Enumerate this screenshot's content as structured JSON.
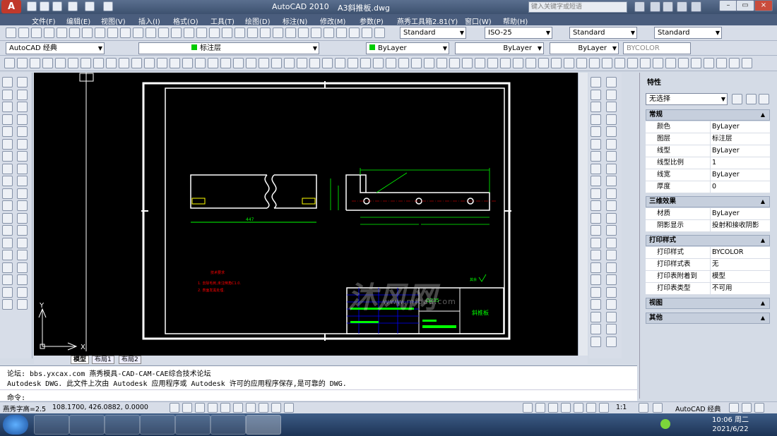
{
  "app": {
    "name": "AutoCAD 2010",
    "file": "A3斜推板.dwg",
    "search_placeholder": "键入关键字或短语"
  },
  "menu": [
    "文件(F)",
    "编辑(E)",
    "视图(V)",
    "插入(I)",
    "格式(O)",
    "工具(T)",
    "绘图(D)",
    "标注(N)",
    "修改(M)",
    "参数(P)",
    "燕秀工具箱2.81(Y)",
    "窗口(W)",
    "帮助(H)"
  ],
  "toolbar": {
    "text_style": "Standard",
    "dim_style": "ISO-25",
    "table_style": "Standard",
    "multileader_style": "Standard"
  },
  "layers": {
    "workspace": "AutoCAD 经典",
    "current_layer": "标注层",
    "color": "ByLayer",
    "linetype": "ByLayer",
    "lineweight": "ByLayer",
    "plotstyle": "BYCOLOR"
  },
  "tabs": [
    "模型",
    "布局1",
    "布局2"
  ],
  "drawing": {
    "material": "Q235",
    "part_name": "斜推板",
    "tech_title": "技术要求",
    "tech_notes": [
      "1. 去除毛刺,未注倒角C1.0.",
      "2. 表面发黑处理."
    ],
    "roughness": "其余"
  },
  "watermark": {
    "main": "沐风网",
    "url": "www.mfcad.com"
  },
  "properties": {
    "title": "特性",
    "selection": "无选择",
    "sections": [
      {
        "name": "常规",
        "rows": [
          [
            "颜色",
            "ByLayer"
          ],
          [
            "图层",
            "标注层"
          ],
          [
            "线型",
            "ByLayer"
          ],
          [
            "线型比例",
            "1"
          ],
          [
            "线宽",
            "ByLayer"
          ],
          [
            "厚度",
            "0"
          ]
        ]
      },
      {
        "name": "三维效果",
        "rows": [
          [
            "材质",
            "ByLayer"
          ],
          [
            "阴影显示",
            "投射和接收阴影"
          ]
        ]
      },
      {
        "name": "打印样式",
        "rows": [
          [
            "打印样式",
            "BYCOLOR"
          ],
          [
            "打印样式表",
            "无"
          ],
          [
            "打印表附着到",
            "模型"
          ],
          [
            "打印表类型",
            "不可用"
          ]
        ]
      },
      {
        "name": "视图",
        "rows": []
      },
      {
        "name": "其他",
        "rows": []
      }
    ]
  },
  "command": {
    "line1": "论坛: bbs.yxcax.com      燕秀模具-CAD-CAM-CAE综合技术论坛",
    "line2": "Autodesk DWG.   此文件上次由 Autodesk 应用程序或 Autodesk 许可的应用程序保存,是可靠的 DWG.",
    "prompt": "命令:"
  },
  "status": {
    "left": "燕秀字高=2.5",
    "coords": "108.1700, 426.0882, 0.0000",
    "scale": "1:1",
    "workspace": "AutoCAD 经典"
  },
  "taskbar": {
    "time": "10:06 周二",
    "date": "2021/6/22"
  },
  "colors": {
    "cad_bg": "#000000",
    "green": "#00ff00",
    "red": "#ff0000",
    "white": "#ffffff"
  }
}
